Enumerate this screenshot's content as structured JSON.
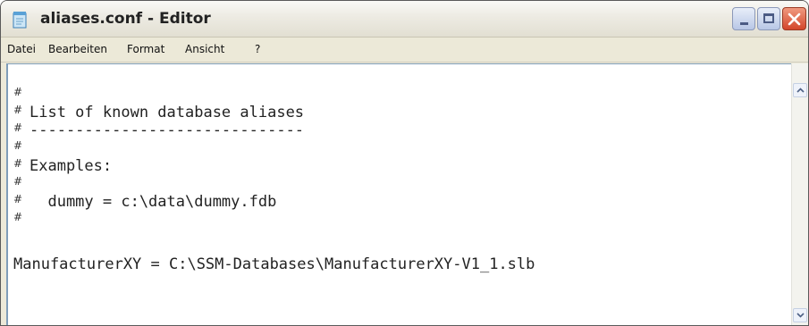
{
  "window": {
    "title": "aliases.conf - Editor",
    "controls": [
      "minimize-icon",
      "maximize-icon",
      "close-icon"
    ]
  },
  "menu": {
    "items": [
      {
        "label": "Datei"
      },
      {
        "label": "Bearbeiten"
      },
      {
        "label": "Format"
      },
      {
        "label": "Ansicht"
      },
      {
        "label": "?"
      }
    ]
  },
  "editor": {
    "lines": [
      {
        "hash": "#",
        "text": ""
      },
      {
        "hash": "#",
        "text": "List of known database aliases"
      },
      {
        "hash": "#",
        "text": "------------------------------"
      },
      {
        "hash": "#",
        "text": ""
      },
      {
        "hash": "#",
        "text": "Examples:"
      },
      {
        "hash": "#",
        "text": ""
      },
      {
        "hash": "#",
        "text": "  dummy = c:\\data\\dummy.fdb"
      },
      {
        "hash": "#",
        "text": ""
      },
      {
        "hash": "",
        "text": ""
      },
      {
        "hash": "",
        "text": "ManufacturerXY = C:\\SSM-Databases\\ManufacturerXY-V1_1.slb"
      }
    ]
  },
  "colors": {
    "close_button": "#d3462a",
    "border_accent": "#7f9db9"
  }
}
